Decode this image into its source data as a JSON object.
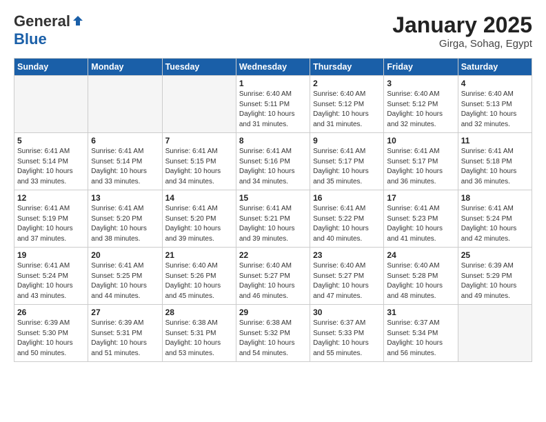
{
  "header": {
    "logo_general": "General",
    "logo_blue": "Blue",
    "title": "January 2025",
    "subtitle": "Girga, Sohag, Egypt"
  },
  "weekdays": [
    "Sunday",
    "Monday",
    "Tuesday",
    "Wednesday",
    "Thursday",
    "Friday",
    "Saturday"
  ],
  "weeks": [
    [
      {
        "day": "",
        "info": ""
      },
      {
        "day": "",
        "info": ""
      },
      {
        "day": "",
        "info": ""
      },
      {
        "day": "1",
        "info": "Sunrise: 6:40 AM\nSunset: 5:11 PM\nDaylight: 10 hours\nand 31 minutes."
      },
      {
        "day": "2",
        "info": "Sunrise: 6:40 AM\nSunset: 5:12 PM\nDaylight: 10 hours\nand 31 minutes."
      },
      {
        "day": "3",
        "info": "Sunrise: 6:40 AM\nSunset: 5:12 PM\nDaylight: 10 hours\nand 32 minutes."
      },
      {
        "day": "4",
        "info": "Sunrise: 6:40 AM\nSunset: 5:13 PM\nDaylight: 10 hours\nand 32 minutes."
      }
    ],
    [
      {
        "day": "5",
        "info": "Sunrise: 6:41 AM\nSunset: 5:14 PM\nDaylight: 10 hours\nand 33 minutes."
      },
      {
        "day": "6",
        "info": "Sunrise: 6:41 AM\nSunset: 5:14 PM\nDaylight: 10 hours\nand 33 minutes."
      },
      {
        "day": "7",
        "info": "Sunrise: 6:41 AM\nSunset: 5:15 PM\nDaylight: 10 hours\nand 34 minutes."
      },
      {
        "day": "8",
        "info": "Sunrise: 6:41 AM\nSunset: 5:16 PM\nDaylight: 10 hours\nand 34 minutes."
      },
      {
        "day": "9",
        "info": "Sunrise: 6:41 AM\nSunset: 5:17 PM\nDaylight: 10 hours\nand 35 minutes."
      },
      {
        "day": "10",
        "info": "Sunrise: 6:41 AM\nSunset: 5:17 PM\nDaylight: 10 hours\nand 36 minutes."
      },
      {
        "day": "11",
        "info": "Sunrise: 6:41 AM\nSunset: 5:18 PM\nDaylight: 10 hours\nand 36 minutes."
      }
    ],
    [
      {
        "day": "12",
        "info": "Sunrise: 6:41 AM\nSunset: 5:19 PM\nDaylight: 10 hours\nand 37 minutes."
      },
      {
        "day": "13",
        "info": "Sunrise: 6:41 AM\nSunset: 5:20 PM\nDaylight: 10 hours\nand 38 minutes."
      },
      {
        "day": "14",
        "info": "Sunrise: 6:41 AM\nSunset: 5:20 PM\nDaylight: 10 hours\nand 39 minutes."
      },
      {
        "day": "15",
        "info": "Sunrise: 6:41 AM\nSunset: 5:21 PM\nDaylight: 10 hours\nand 39 minutes."
      },
      {
        "day": "16",
        "info": "Sunrise: 6:41 AM\nSunset: 5:22 PM\nDaylight: 10 hours\nand 40 minutes."
      },
      {
        "day": "17",
        "info": "Sunrise: 6:41 AM\nSunset: 5:23 PM\nDaylight: 10 hours\nand 41 minutes."
      },
      {
        "day": "18",
        "info": "Sunrise: 6:41 AM\nSunset: 5:24 PM\nDaylight: 10 hours\nand 42 minutes."
      }
    ],
    [
      {
        "day": "19",
        "info": "Sunrise: 6:41 AM\nSunset: 5:24 PM\nDaylight: 10 hours\nand 43 minutes."
      },
      {
        "day": "20",
        "info": "Sunrise: 6:41 AM\nSunset: 5:25 PM\nDaylight: 10 hours\nand 44 minutes."
      },
      {
        "day": "21",
        "info": "Sunrise: 6:40 AM\nSunset: 5:26 PM\nDaylight: 10 hours\nand 45 minutes."
      },
      {
        "day": "22",
        "info": "Sunrise: 6:40 AM\nSunset: 5:27 PM\nDaylight: 10 hours\nand 46 minutes."
      },
      {
        "day": "23",
        "info": "Sunrise: 6:40 AM\nSunset: 5:27 PM\nDaylight: 10 hours\nand 47 minutes."
      },
      {
        "day": "24",
        "info": "Sunrise: 6:40 AM\nSunset: 5:28 PM\nDaylight: 10 hours\nand 48 minutes."
      },
      {
        "day": "25",
        "info": "Sunrise: 6:39 AM\nSunset: 5:29 PM\nDaylight: 10 hours\nand 49 minutes."
      }
    ],
    [
      {
        "day": "26",
        "info": "Sunrise: 6:39 AM\nSunset: 5:30 PM\nDaylight: 10 hours\nand 50 minutes."
      },
      {
        "day": "27",
        "info": "Sunrise: 6:39 AM\nSunset: 5:31 PM\nDaylight: 10 hours\nand 51 minutes."
      },
      {
        "day": "28",
        "info": "Sunrise: 6:38 AM\nSunset: 5:31 PM\nDaylight: 10 hours\nand 53 minutes."
      },
      {
        "day": "29",
        "info": "Sunrise: 6:38 AM\nSunset: 5:32 PM\nDaylight: 10 hours\nand 54 minutes."
      },
      {
        "day": "30",
        "info": "Sunrise: 6:37 AM\nSunset: 5:33 PM\nDaylight: 10 hours\nand 55 minutes."
      },
      {
        "day": "31",
        "info": "Sunrise: 6:37 AM\nSunset: 5:34 PM\nDaylight: 10 hours\nand 56 minutes."
      },
      {
        "day": "",
        "info": ""
      }
    ]
  ]
}
